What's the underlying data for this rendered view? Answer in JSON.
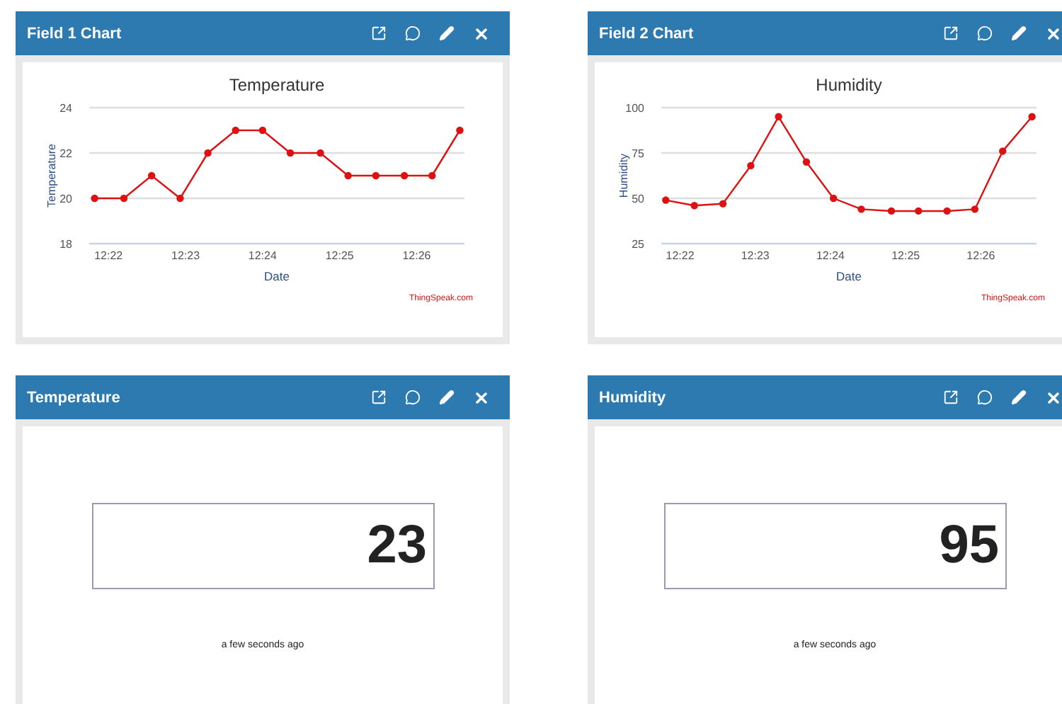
{
  "panels": [
    {
      "kind": "chart",
      "title": "Field 1 Chart",
      "credit": "ThingSpeak.com",
      "chart_data": {
        "type": "line",
        "title": "Temperature",
        "xlabel": "Date",
        "ylabel": "Temperature",
        "x": [
          741.82,
          742.2,
          742.56,
          742.93,
          743.29,
          743.65,
          744.0,
          744.36,
          744.75,
          745.11,
          745.47,
          745.84,
          746.2,
          746.56
        ],
        "series": [
          {
            "color": "#dd1111",
            "marker": "circle",
            "values": [
              20,
              20,
              21,
              20,
              22,
              23,
              23,
              22,
              22,
              21,
              21,
              21,
              21,
              23
            ]
          }
        ],
        "xlim": [
          741.75,
          746.62
        ],
        "ylim": [
          18,
          24
        ],
        "yticks": [
          18,
          20,
          22,
          24
        ],
        "xticks": [
          {
            "value": 742,
            "label": "12:22"
          },
          {
            "value": 743,
            "label": "12:23"
          },
          {
            "value": 744,
            "label": "12:24"
          },
          {
            "value": 745,
            "label": "12:25"
          },
          {
            "value": 746,
            "label": "12:26"
          }
        ]
      }
    },
    {
      "kind": "chart",
      "title": "Field 2 Chart",
      "credit": "ThingSpeak.com",
      "chart_data": {
        "type": "line",
        "title": "Humidity",
        "xlabel": "Date",
        "ylabel": "Humidity",
        "x": [
          741.81,
          742.19,
          742.57,
          742.94,
          743.31,
          743.68,
          744.04,
          744.41,
          744.81,
          745.17,
          745.55,
          745.92,
          746.29,
          746.68
        ],
        "series": [
          {
            "color": "#dd1111",
            "marker": "circle",
            "values": [
              49,
              46,
              47,
              68,
              95,
              70,
              50,
              44,
              43,
              43,
              43,
              44,
              76,
              95
            ]
          }
        ],
        "xlim": [
          741.75,
          746.74
        ],
        "ylim": [
          25,
          100
        ],
        "yticks": [
          25,
          50,
          75,
          100
        ],
        "xticks": [
          {
            "value": 742,
            "label": "12:22"
          },
          {
            "value": 743,
            "label": "12:23"
          },
          {
            "value": 744,
            "label": "12:24"
          },
          {
            "value": 745,
            "label": "12:25"
          },
          {
            "value": 746,
            "label": "12:26"
          }
        ]
      }
    },
    {
      "kind": "gauge",
      "title": "Temperature",
      "value": "23",
      "timestamp": "a few seconds ago"
    },
    {
      "kind": "gauge",
      "title": "Humidity",
      "value": "95",
      "timestamp": "a few seconds ago"
    }
  ]
}
